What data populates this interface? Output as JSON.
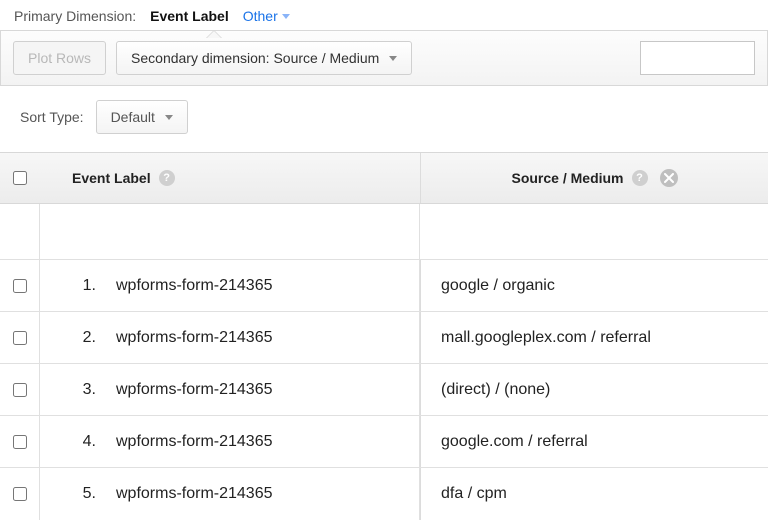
{
  "primary": {
    "label": "Primary Dimension:",
    "active": "Event Label",
    "other": "Other"
  },
  "toolbar": {
    "plot_rows": "Plot Rows",
    "secondary_label": "Secondary dimension: Source / Medium"
  },
  "sort": {
    "label": "Sort Type:",
    "value": "Default"
  },
  "headers": {
    "event_label": "Event Label",
    "source_medium": "Source / Medium"
  },
  "rows": [
    {
      "idx": "1.",
      "label": "wpforms-form-214365",
      "source": "google / organic"
    },
    {
      "idx": "2.",
      "label": "wpforms-form-214365",
      "source": "mall.googleplex.com / referral"
    },
    {
      "idx": "3.",
      "label": "wpforms-form-214365",
      "source": "(direct) / (none)"
    },
    {
      "idx": "4.",
      "label": "wpforms-form-214365",
      "source": "google.com / referral"
    },
    {
      "idx": "5.",
      "label": "wpforms-form-214365",
      "source": "dfa / cpm"
    }
  ]
}
